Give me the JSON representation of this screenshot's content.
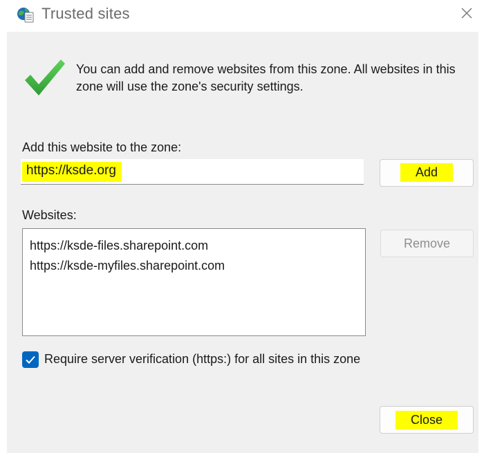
{
  "window": {
    "title": "Trusted sites"
  },
  "icons": {
    "title": "globe-checklist-icon",
    "close": "close-icon",
    "success": "checkmark-icon",
    "checkbox": "checkbox-checked-icon"
  },
  "intro": {
    "text": "You can add and remove websites from this zone. All websites in this zone will use the zone's security settings."
  },
  "add_section": {
    "label": "Add this website to the zone:",
    "input_value": "https://ksde.org",
    "add_button": "Add"
  },
  "websites": {
    "label": "Websites:",
    "items": [
      "https://ksde-files.sharepoint.com",
      "https://ksde-myfiles.sharepoint.com"
    ],
    "remove_button": "Remove"
  },
  "verification": {
    "label": "Require server verification (https:) for all sites in this zone",
    "checked": true
  },
  "footer": {
    "close_button": "Close"
  },
  "colors": {
    "highlight": "#ffff00",
    "accent": "#0067c0",
    "check_green": "#3cb043",
    "content_bg": "#f0f0f0"
  }
}
